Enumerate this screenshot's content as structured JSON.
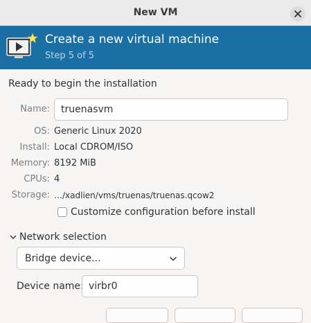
{
  "window": {
    "title": "New VM"
  },
  "banner": {
    "title": "Create a new virtual machine",
    "step": "Step 5 of 5"
  },
  "summary": {
    "heading": "Ready to begin the installation",
    "name_label": "Name:",
    "name_value": "truenasvm",
    "os_label": "OS:",
    "os_value": "Generic Linux 2020",
    "install_label": "Install:",
    "install_value": "Local CDROM/ISO",
    "memory_label": "Memory:",
    "memory_value": "8192 MiB",
    "cpus_label": "CPUs:",
    "cpus_value": "4",
    "storage_label": "Storage:",
    "storage_value": "…/xadlien/vms/truenas/truenas.qcow2"
  },
  "customize": {
    "label": "Customize configuration before install",
    "checked": false
  },
  "network": {
    "expander_label": "Network selection",
    "source_selected": "Bridge device...",
    "device_label": "Device name:",
    "device_value": "virbr0"
  }
}
